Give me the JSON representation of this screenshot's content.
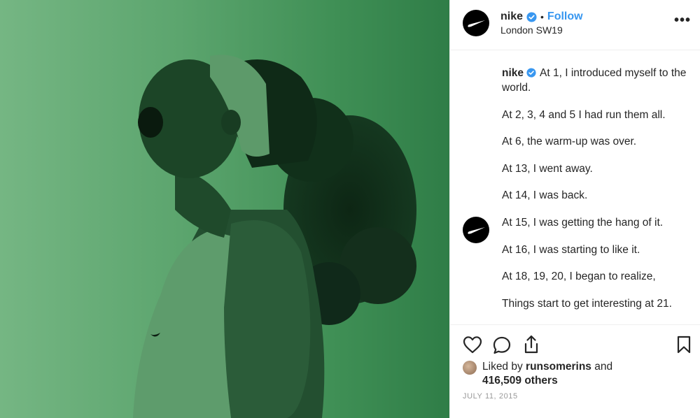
{
  "post": {
    "username": "nike",
    "follow_label": "Follow",
    "separator": "•",
    "location": "London SW19",
    "more_label": "•••"
  },
  "caption": {
    "username": "nike",
    "lines": [
      "At 1, I introduced myself to the world.",
      "At 2, 3, 4 and 5 I had run them all.",
      "At 6, the warm-up was over.",
      "At 13, I went away.",
      "At 14, I was back.",
      "At 15, I was getting the hang of it.",
      "At 16, I was starting to like it.",
      "At 18, 19, 20, I began to realize,",
      "Things start to get interesting at 21."
    ]
  },
  "likes": {
    "prefix": "Liked by",
    "liker": "runsomerins",
    "conjunction": "and",
    "count_text": "416,509 others"
  },
  "date": "JULY 11, 2015",
  "icons": [
    "nike-swoosh-icon",
    "verified-badge-icon",
    "heart-icon",
    "comment-icon",
    "share-icon",
    "bookmark-icon",
    "more-options-icon"
  ],
  "colors": {
    "accent": "#3897f0",
    "photo_green": "#4f9b63",
    "text": "#262626",
    "muted": "#999999"
  }
}
